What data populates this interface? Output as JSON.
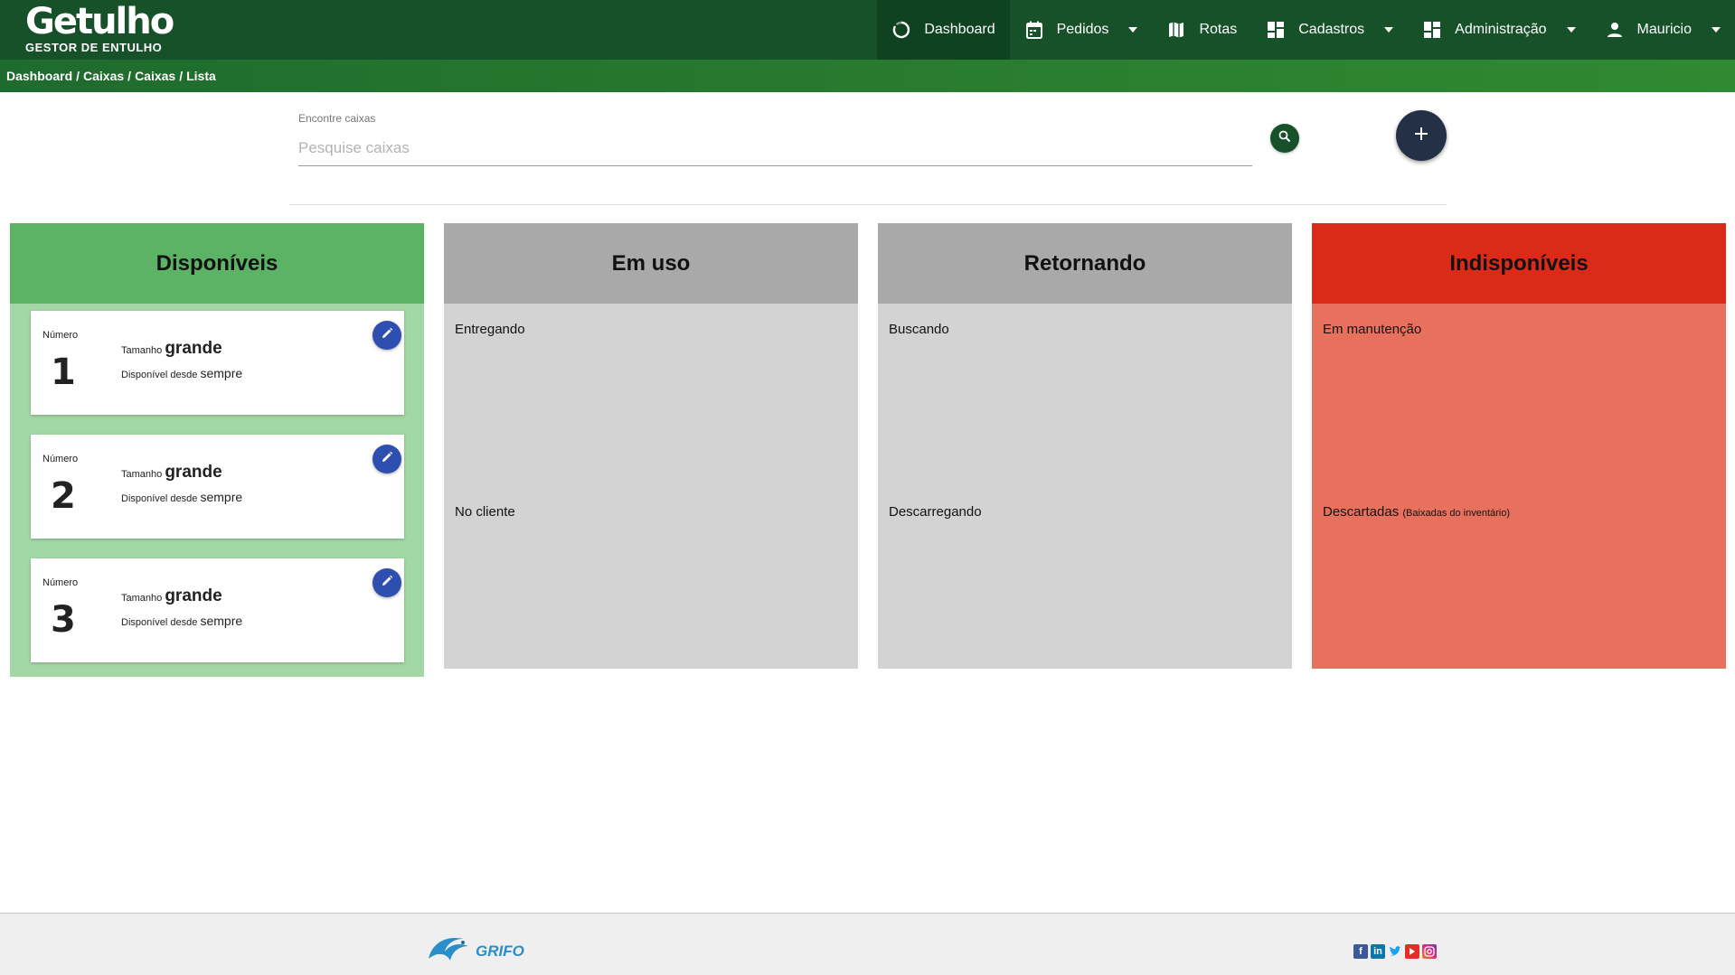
{
  "brand": {
    "name": "Getulho",
    "tagline": "GESTOR DE ENTULHO"
  },
  "nav": {
    "items": [
      {
        "label": "Dashboard",
        "icon": "dashboard-icon",
        "active": true
      },
      {
        "label": "Pedidos",
        "icon": "calendar-icon",
        "dropdown": true
      },
      {
        "label": "Rotas",
        "icon": "map-icon"
      },
      {
        "label": "Cadastros",
        "icon": "grid-icon",
        "dropdown": true
      },
      {
        "label": "Administração",
        "icon": "grid-icon",
        "dropdown": true
      },
      {
        "label": "Mauricio",
        "icon": "user-icon",
        "dropdown": true
      }
    ]
  },
  "breadcrumb": [
    "Dashboard",
    "Caixas",
    "Caixas",
    "Lista"
  ],
  "search": {
    "label": "Encontre caixas",
    "placeholder": "Pesquise caixas"
  },
  "columns": {
    "available": {
      "title": "Disponíveis",
      "cards": [
        {
          "number_label": "Número",
          "number": "1",
          "size_label": "Tamanho",
          "size": "grande",
          "since_label": "Disponível desde",
          "since": "sempre"
        },
        {
          "number_label": "Número",
          "number": "2",
          "size_label": "Tamanho",
          "size": "grande",
          "since_label": "Disponível desde",
          "since": "sempre"
        },
        {
          "number_label": "Número",
          "number": "3",
          "size_label": "Tamanho",
          "size": "grande",
          "since_label": "Disponível desde",
          "since": "sempre"
        }
      ]
    },
    "in_use": {
      "title": "Em uso",
      "sub1": "Entregando",
      "sub2": "No cliente"
    },
    "returning": {
      "title": "Retornando",
      "sub1": "Buscando",
      "sub2": "Descarregando"
    },
    "unavailable": {
      "title": "Indisponíveis",
      "sub1": "Em manutenção",
      "sub2": "Descartadas",
      "sub2_note": "(Baixadas do inventário)"
    }
  },
  "footer": {
    "company": "GRIFO",
    "socials": [
      "facebook-icon",
      "linkedin-icon",
      "twitter-icon",
      "youtube-icon",
      "instagram-icon"
    ]
  },
  "colors": {
    "navbar": "#17512a",
    "available": "#5cb265",
    "in_use": "#a9a9a9",
    "unavailable": "#dc2a18",
    "edit": "#2f4fb0",
    "add": "#233045"
  }
}
